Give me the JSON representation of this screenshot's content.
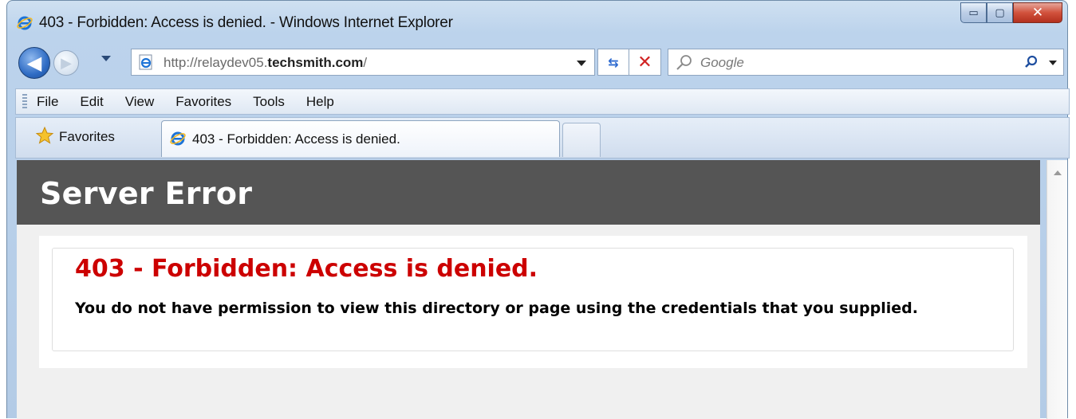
{
  "window": {
    "title": "403 - Forbidden: Access is denied. - Windows Internet Explorer",
    "caption_buttons": {
      "minimize": "▭",
      "maximize": "▢",
      "close": "✕"
    }
  },
  "navigation": {
    "back_glyph": "◀",
    "forward_glyph": "▶",
    "address": {
      "prefix": "http://relaydev05.",
      "domain": "techsmith.com",
      "suffix": "/"
    },
    "refresh_glyph": "⇆",
    "stop_glyph": "✕",
    "search": {
      "placeholder": "Google"
    }
  },
  "menu": {
    "items": [
      "File",
      "Edit",
      "View",
      "Favorites",
      "Tools",
      "Help"
    ]
  },
  "tabs": {
    "favorites_label": "Favorites",
    "active_tab_label": "403 - Forbidden: Access is denied."
  },
  "page": {
    "header_title": "Server Error",
    "error_heading": "403 - Forbidden: Access is denied.",
    "error_message": "You do not have permission to view this directory or page using the credentials that you supplied."
  },
  "colors": {
    "header_band": "#555555",
    "error_red": "#cc0000"
  },
  "icons": {
    "title": "ie-logo-icon",
    "address": "ie-page-icon",
    "search": "magnifier-icon",
    "favorites": "star-icon",
    "tab": "ie-logo-icon"
  }
}
